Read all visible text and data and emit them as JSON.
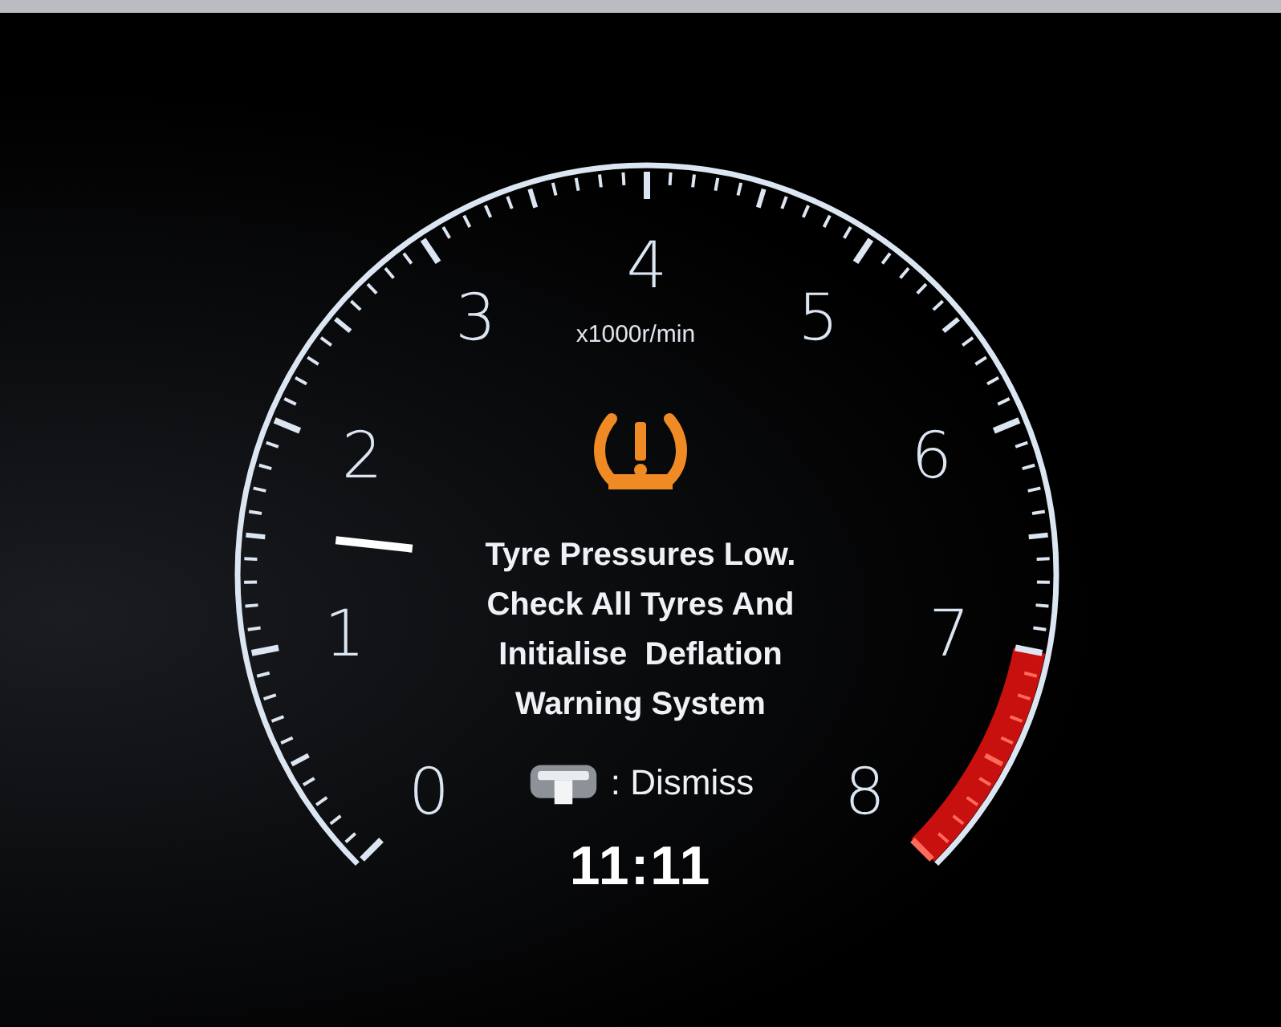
{
  "tachometer": {
    "scale_labels": [
      "0",
      "1",
      "2",
      "3",
      "4",
      "5",
      "6",
      "7",
      "8"
    ],
    "unit": "x1000r/min",
    "needle": {
      "level": 0.19
    }
  },
  "warning": {
    "message_lines": [
      "Tyre Pressures Low.",
      "Check All Tyres And",
      "Initialise  Deflation",
      "Warning System"
    ],
    "dismiss_label": ": Dismiss"
  },
  "clock": "11:11"
}
